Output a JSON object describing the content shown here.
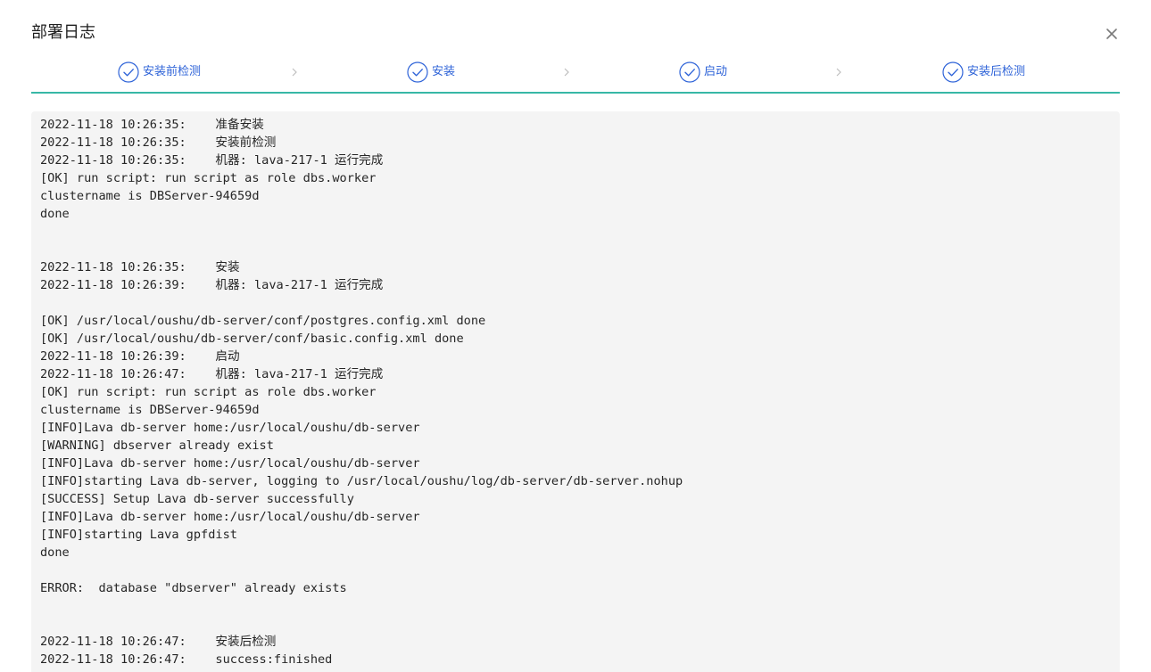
{
  "dialog": {
    "title": "部署日志",
    "close_icon": "close-icon"
  },
  "steps": [
    {
      "label": "安装前检测",
      "icon": "check-circle-icon"
    },
    {
      "label": "安装",
      "icon": "check-circle-icon"
    },
    {
      "label": "启动",
      "icon": "check-circle-icon"
    },
    {
      "label": "安装后检测",
      "icon": "check-circle-icon"
    }
  ],
  "colors": {
    "accent": "#2e63d8",
    "step_underline": "#37b7a6",
    "log_background": "#f4f4f4"
  },
  "log": [
    "2022-11-18 10:26:35:    准备安装",
    "2022-11-18 10:26:35:    安装前检测",
    "2022-11-18 10:26:35:    机器: lava-217-1 运行完成",
    "[OK] run script: run script as role dbs.worker",
    "clustername is DBServer-94659d",
    "done",
    "",
    "",
    "2022-11-18 10:26:35:    安装",
    "2022-11-18 10:26:39:    机器: lava-217-1 运行完成",
    "",
    "[OK] /usr/local/oushu/db-server/conf/postgres.config.xml done",
    "[OK] /usr/local/oushu/db-server/conf/basic.config.xml done",
    "2022-11-18 10:26:39:    启动",
    "2022-11-18 10:26:47:    机器: lava-217-1 运行完成",
    "[OK] run script: run script as role dbs.worker",
    "clustername is DBServer-94659d",
    "[INFO]Lava db-server home:/usr/local/oushu/db-server",
    "[WARNING] dbserver already exist",
    "[INFO]Lava db-server home:/usr/local/oushu/db-server",
    "[INFO]starting Lava db-server, logging to /usr/local/oushu/log/db-server/db-server.nohup",
    "[SUCCESS] Setup Lava db-server successfully",
    "[INFO]Lava db-server home:/usr/local/oushu/db-server",
    "[INFO]starting Lava gpfdist",
    "done",
    "",
    "ERROR:  database \"dbserver\" already exists",
    "",
    "",
    "2022-11-18 10:26:47:    安装后检测",
    "2022-11-18 10:26:47:    success:finished"
  ]
}
